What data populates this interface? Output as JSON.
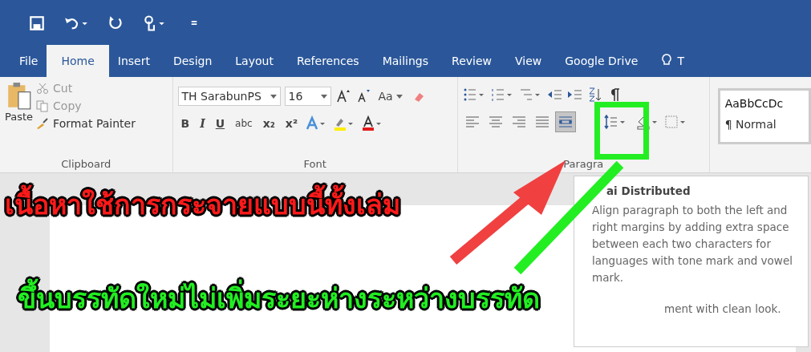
{
  "tabs": [
    {
      "label": "File",
      "selected": false
    },
    {
      "label": "Home",
      "selected": true
    },
    {
      "label": "Insert",
      "selected": false
    },
    {
      "label": "Design",
      "selected": false
    },
    {
      "label": "Layout",
      "selected": false
    },
    {
      "label": "References",
      "selected": false
    },
    {
      "label": "Mailings",
      "selected": false
    },
    {
      "label": "Review",
      "selected": false
    },
    {
      "label": "View",
      "selected": false
    },
    {
      "label": "Google Drive",
      "selected": false
    }
  ],
  "tell_me": "T",
  "clipboard": {
    "paste": "Paste",
    "cut": "Cut",
    "copy": "Copy",
    "format_painter": "Format Painter",
    "label": "Clipboard"
  },
  "font": {
    "name": "TH SarabunPS",
    "size": "16",
    "case": "Aa",
    "format_buttons": [
      "B",
      "I",
      "U",
      "abc",
      "x₂",
      "x²"
    ],
    "label": "Font"
  },
  "paragraph": {
    "alignments": [
      {
        "kind": "left",
        "selected": false
      },
      {
        "kind": "center",
        "selected": false
      },
      {
        "kind": "right",
        "selected": false
      },
      {
        "kind": "justify",
        "selected": false
      },
      {
        "kind": "distributed",
        "selected": true
      }
    ],
    "label": "Paragra"
  },
  "styles": {
    "sample": "AaBbCcDc",
    "name": "¶ Normal"
  },
  "tooltip": {
    "title": "ai Distributed",
    "body": "Align paragraph to both the left and right margins by adding extra space between each two characters for languages with tone mark and vowel mark.",
    "tail": "ment with clean look."
  },
  "annotations": [
    {
      "text": "เนื้อหาใช้การกระจายแบบนี้ทั้งเล่ม",
      "color": "#ff1a1a"
    },
    {
      "text": "ขึ้นบรรทัดใหม่ไม่เพิ่มระยะห่างระหว่างบรรทัด",
      "color": "#22ee22"
    }
  ]
}
